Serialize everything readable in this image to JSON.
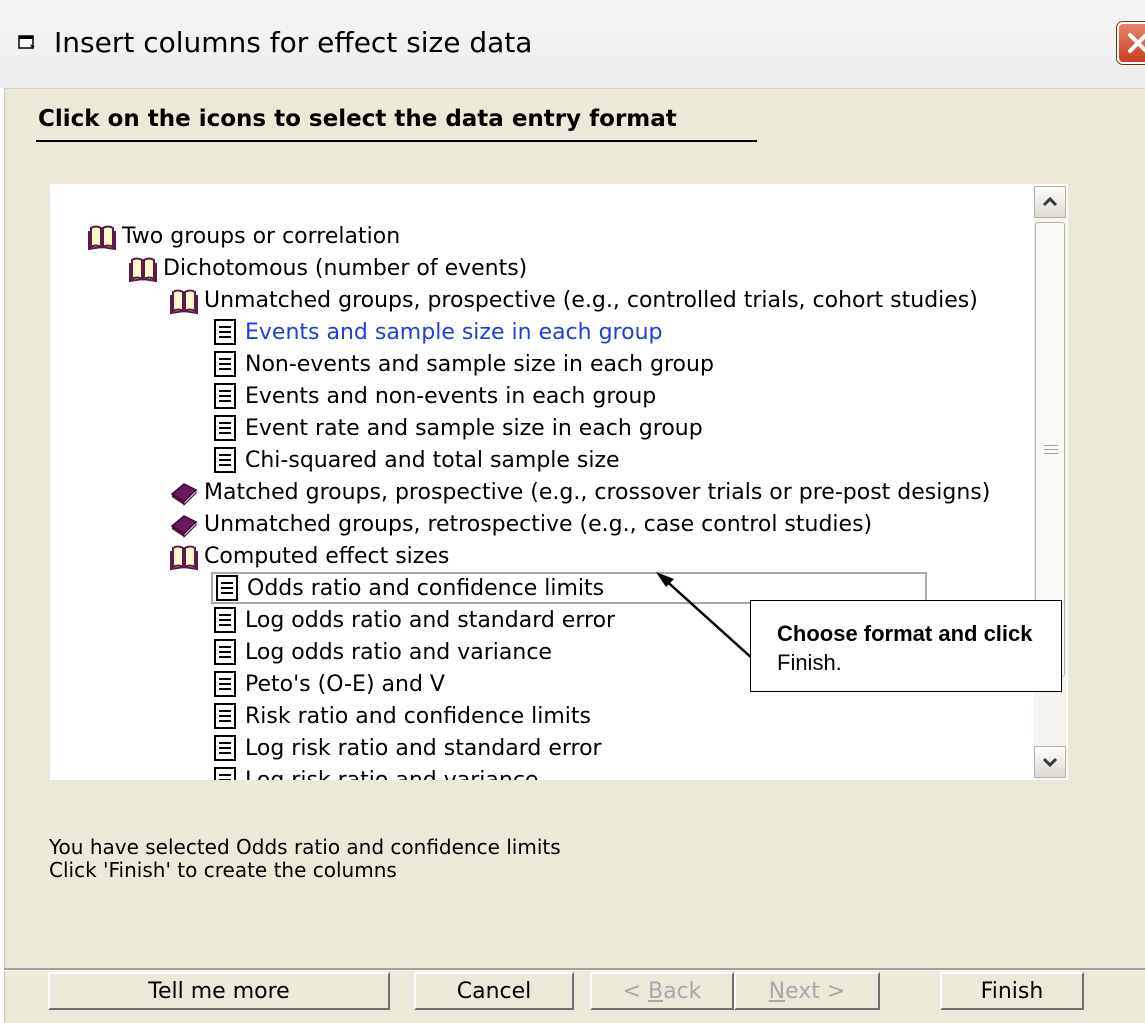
{
  "window": {
    "title": "Insert columns for effect size data"
  },
  "instruction": "Click on the icons to select the data entry format",
  "tree": [
    {
      "label": "Two groups or correlation",
      "icon": "open-book-icon",
      "level": 0
    },
    {
      "label": "Dichotomous (number of events)",
      "icon": "open-book-icon",
      "level": 1
    },
    {
      "label": "Unmatched groups, prospective (e.g., controlled trials, cohort studies)",
      "icon": "open-book-icon",
      "level": 2
    },
    {
      "label": "Events and sample size in each group",
      "icon": "document-icon",
      "level": 3,
      "highlight": true
    },
    {
      "label": "Non-events and sample size in each group",
      "icon": "document-icon",
      "level": 3
    },
    {
      "label": "Events and non-events in each group",
      "icon": "document-icon",
      "level": 3
    },
    {
      "label": "Event rate and sample size in each group",
      "icon": "document-icon",
      "level": 3
    },
    {
      "label": "Chi-squared and total sample size",
      "icon": "document-icon",
      "level": 3
    },
    {
      "label": "Matched groups, prospective (e.g., crossover trials or pre-post designs)",
      "icon": "closed-book-icon",
      "level": 2
    },
    {
      "label": "Unmatched groups, retrospective (e.g., case control studies)",
      "icon": "closed-book-icon",
      "level": 2
    },
    {
      "label": "Computed effect sizes",
      "icon": "open-book-icon",
      "level": 2
    },
    {
      "label": "Odds ratio and confidence limits",
      "icon": "document-icon",
      "level": 3,
      "selected": true
    },
    {
      "label": "Log odds ratio and standard error",
      "icon": "document-icon",
      "level": 3
    },
    {
      "label": "Log odds ratio and variance",
      "icon": "document-icon",
      "level": 3
    },
    {
      "label": "Peto's (O-E) and V",
      "icon": "document-icon",
      "level": 3
    },
    {
      "label": "Risk ratio and confidence limits",
      "icon": "document-icon",
      "level": 3
    },
    {
      "label": "Log risk ratio and standard error",
      "icon": "document-icon",
      "level": 3
    },
    {
      "label": "Log risk ratio and variance",
      "icon": "document-icon",
      "level": 3
    }
  ],
  "callout": {
    "bold_text": "Choose format and click",
    "plain_text": "Finish."
  },
  "status": {
    "line1": "You have selected Odds ratio and confidence limits",
    "line2": "Click 'Finish' to create the columns"
  },
  "buttons": {
    "tell_me_more": "Tell me more",
    "cancel": "Cancel",
    "back_prefix": "< ",
    "back_underline": "B",
    "back_rest": "ack",
    "next_underline": "N",
    "next_rest": "ext >",
    "finish": "Finish"
  },
  "colors": {
    "highlight_link": "#1f3fdc",
    "dialog_bg": "#ece9d8",
    "close_button": "#c6401f"
  }
}
